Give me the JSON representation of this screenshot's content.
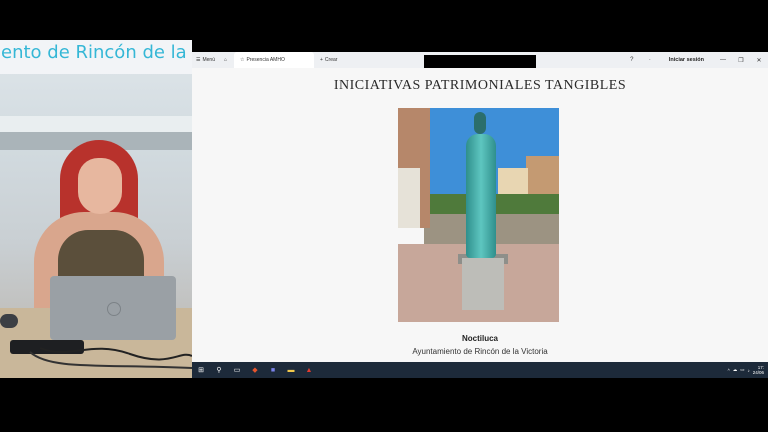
{
  "webcam": {
    "banner_text": "iento de Rincón de la"
  },
  "browser": {
    "menu_label": "Menú",
    "tab_active_label": "Presencia AMHO",
    "new_tab_label": "Crear",
    "login_label": "Iniciar sesión",
    "icons": {
      "menu": "hamburger-icon",
      "home": "home-icon",
      "tab": "star-icon",
      "new_tab": "plus-icon",
      "help": "question-icon",
      "minimize": "minimize-icon",
      "restore": "restore-icon",
      "close": "close-icon"
    }
  },
  "slide": {
    "title": "INICIATIVAS PATRIMONIALES TANGIBLES",
    "caption_title": "Noctiluca",
    "caption_subtitle": "Ayuntamiento de Rincón de la Victoria"
  },
  "taskbar": {
    "clock_time": "17:",
    "clock_date": "24/06",
    "icons": [
      "windows-start-icon",
      "search-icon",
      "task-view-icon",
      "brave-browser-icon",
      "teams-icon",
      "file-explorer-icon",
      "acrobat-icon"
    ]
  },
  "colors": {
    "banner_text": "#35b7d6",
    "taskbar": "#1d2a3a",
    "slide_bg": "#f7f7f7"
  }
}
